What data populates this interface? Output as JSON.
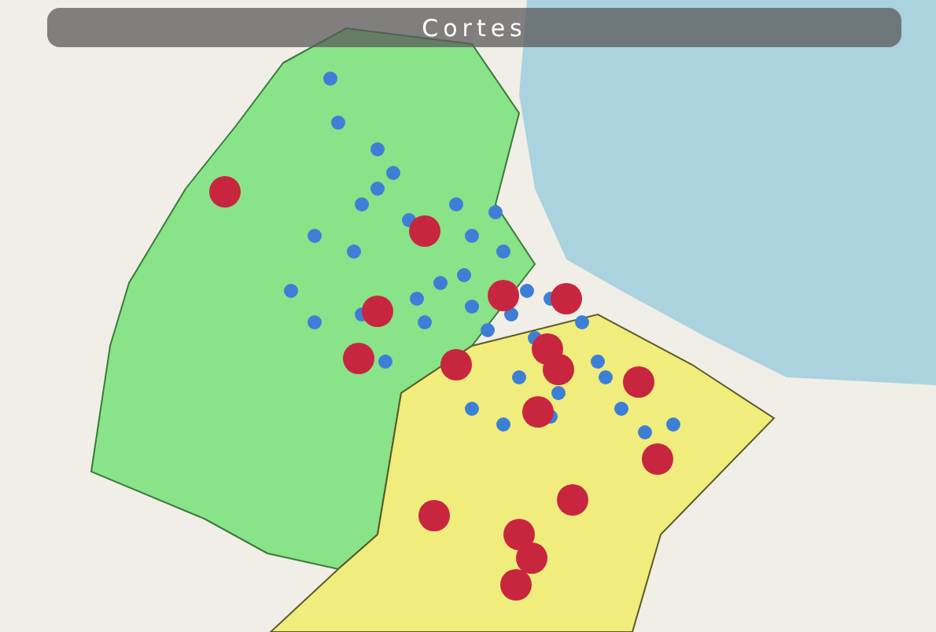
{
  "header": {
    "title": "Cortes"
  }
}
